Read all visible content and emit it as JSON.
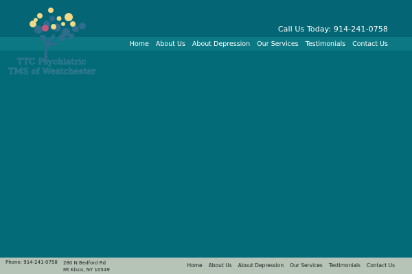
{
  "header": {
    "call_text": "Call Us Today: 914-241-0758",
    "logo": {
      "line1": "TTC Psychiatric",
      "line2": "TMS of Westchester",
      "icon": "tree-icon"
    }
  },
  "nav": {
    "items": [
      {
        "label": "Home"
      },
      {
        "label": "About Us"
      },
      {
        "label": "About Depression"
      },
      {
        "label": "Our Services"
      },
      {
        "label": "Testimonials"
      },
      {
        "label": "Contact Us"
      }
    ]
  },
  "footer": {
    "phone": "Phone: 914-241-0758",
    "address_line1": "280 N Bedford Rd",
    "address_line2": "Mt Kisco, NY 10549",
    "nav": [
      {
        "label": "Home"
      },
      {
        "label": "About Us"
      },
      {
        "label": "About Depression"
      },
      {
        "label": "Our Services"
      },
      {
        "label": "Testimonials"
      },
      {
        "label": "Contact Us"
      }
    ]
  },
  "colors": {
    "background": "#036a78",
    "nav_band": "#0b7883",
    "footer": "#b5c4b6",
    "accent_yellow": "#f2d98a",
    "accent_pink": "#c4567a"
  }
}
